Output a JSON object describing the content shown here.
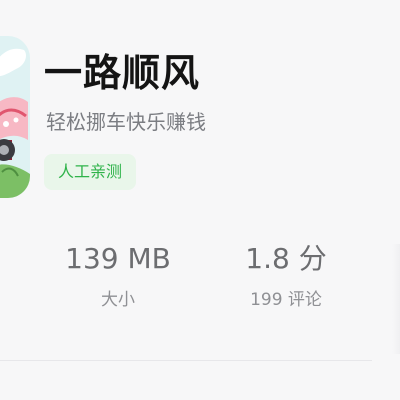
{
  "app": {
    "title": "一路顺风",
    "subtitle": "轻松挪车快乐赚钱",
    "badge": "人工亲测",
    "icon": "app-icon-car-illustration"
  },
  "stats": {
    "size_value": "139 MB",
    "size_label": "大小",
    "rating_value": "1.8 分",
    "rating_label": "199 评论"
  }
}
